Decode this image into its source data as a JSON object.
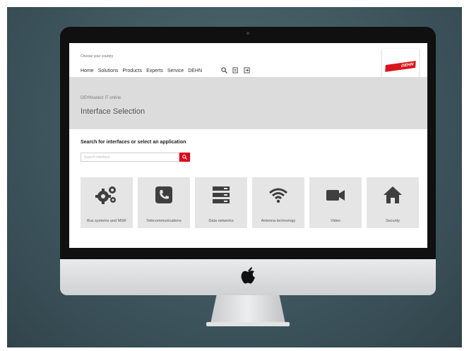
{
  "site": {
    "country_label": "Choose your country",
    "nav": [
      "Home",
      "Solutions",
      "Products",
      "Experts",
      "Service",
      "DEHN"
    ],
    "nav_icons": [
      "search-icon",
      "document-icon",
      "login-icon"
    ],
    "logo_text": "DEHN",
    "breadcrumb": "DEHNselect IT online",
    "page_title": "Interface Selection",
    "search_heading": "Search for interfaces or select an application",
    "search_placeholder": "Search interface",
    "search_button_icon": "search-icon",
    "tiles": [
      {
        "label": "Bus systems and MSR",
        "icon": "gears-icon"
      },
      {
        "label": "Telecommunications",
        "icon": "phone-icon"
      },
      {
        "label": "Data networks",
        "icon": "server-icon"
      },
      {
        "label": "Antenna technology",
        "icon": "wifi-icon"
      },
      {
        "label": "Video",
        "icon": "video-camera-icon"
      },
      {
        "label": "Security",
        "icon": "house-icon"
      }
    ],
    "accent_color": "#e1001a"
  },
  "device": {
    "logo_icon": "apple-logo-icon"
  }
}
